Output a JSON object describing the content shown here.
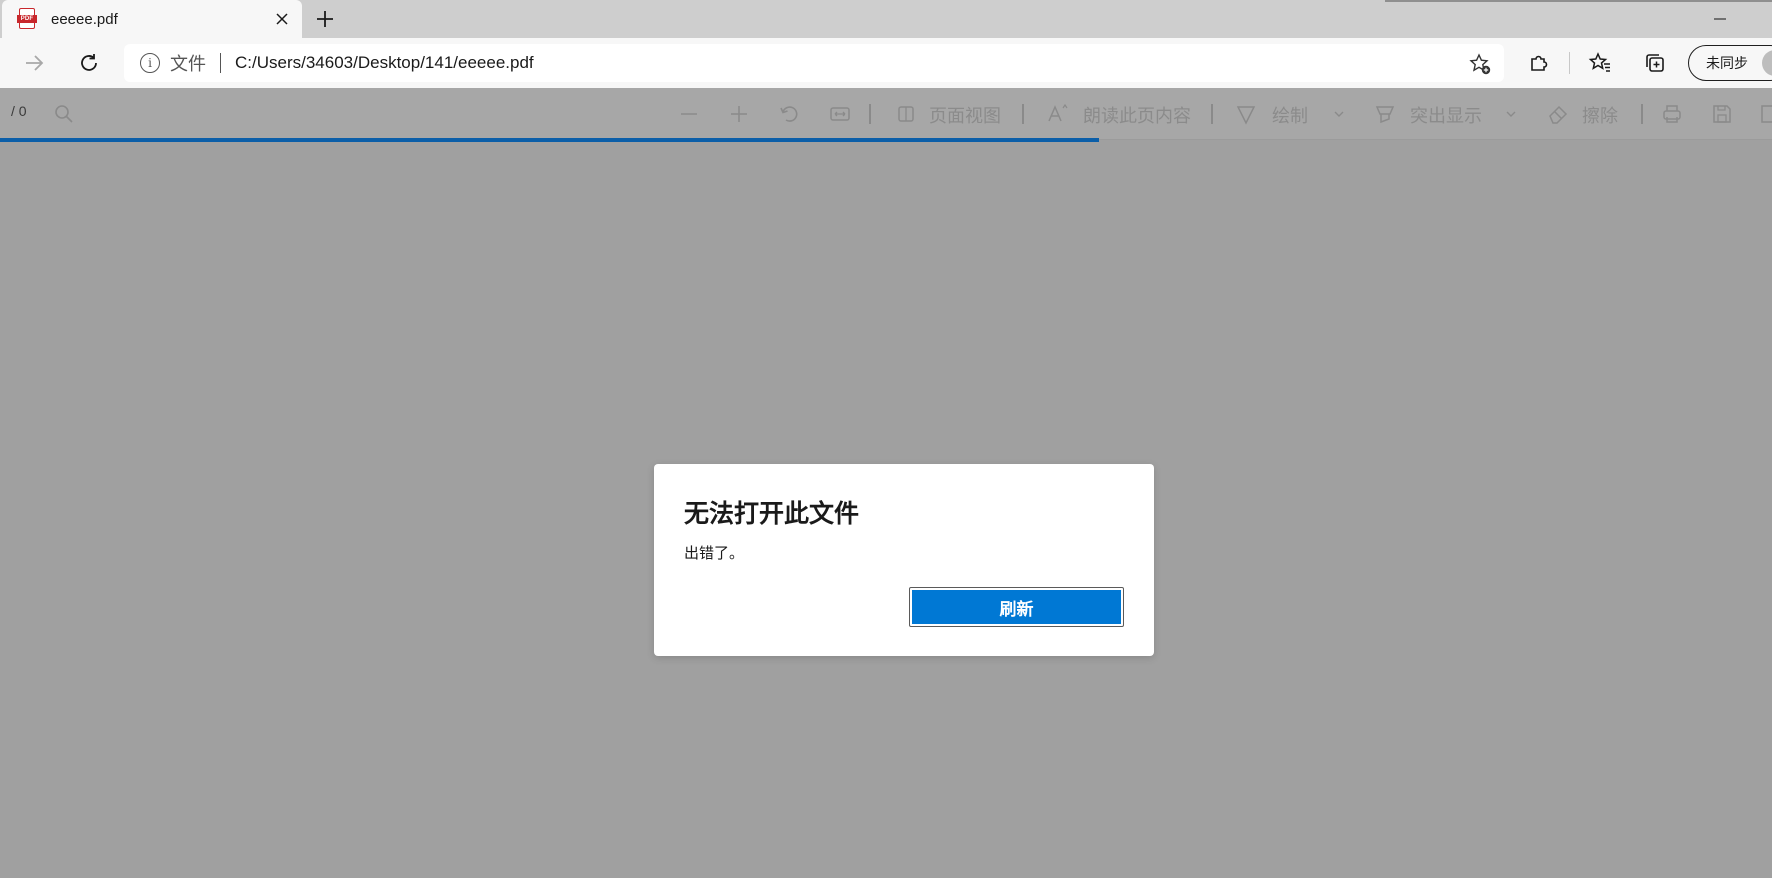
{
  "tab": {
    "favicon_text": "PDF",
    "title": "eeeee.pdf"
  },
  "address_bar": {
    "scheme_label": "文件",
    "url": "C:/Users/34603/Desktop/141/eeeee.pdf"
  },
  "profile": {
    "sync_label": "未同步"
  },
  "pdf_toolbar": {
    "page_count": "/ 0",
    "page_view_label": "页面视图",
    "read_aloud_label": "朗读此页内容",
    "draw_label": "绘制",
    "highlight_label": "突出显示",
    "erase_label": "擦除"
  },
  "loading_progress_fraction": 0.62,
  "dialog": {
    "title": "无法打开此文件",
    "message": "出错了。",
    "refresh_label": "刷新"
  },
  "colors": {
    "accent": "#0078d4",
    "progress": "#0b5ea8",
    "overlay": "#a0a0a0"
  }
}
